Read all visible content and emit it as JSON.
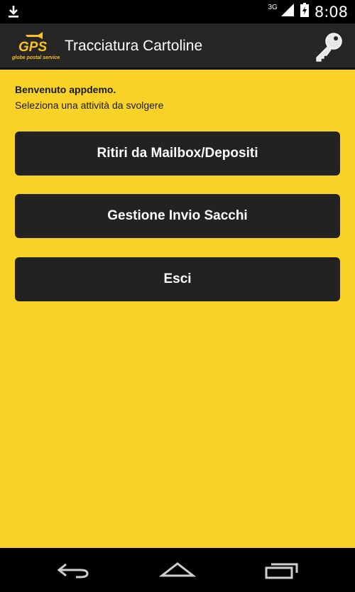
{
  "status_bar": {
    "network": "3G",
    "time": "8:08",
    "icons": [
      "download-icon",
      "signal-icon",
      "battery-icon"
    ]
  },
  "action_bar": {
    "logo_text": "GPS",
    "logo_subtext": "globe postal service",
    "title": "Tracciatura Cartoline",
    "key_icon": "key-icon"
  },
  "main": {
    "welcome": "Benvenuto appdemo.",
    "subtitle": "Seleziona una attività da svolgere",
    "buttons": [
      {
        "label": "Ritiri da Mailbox/Depositi"
      },
      {
        "label": "Gestione Invio Sacchi"
      },
      {
        "label": "Esci"
      }
    ]
  },
  "nav_bar": {
    "icons": [
      "back-icon",
      "home-icon",
      "recents-icon"
    ]
  },
  "colors": {
    "background": "#f9d227",
    "button": "#222222",
    "action_bar": "#262626"
  }
}
